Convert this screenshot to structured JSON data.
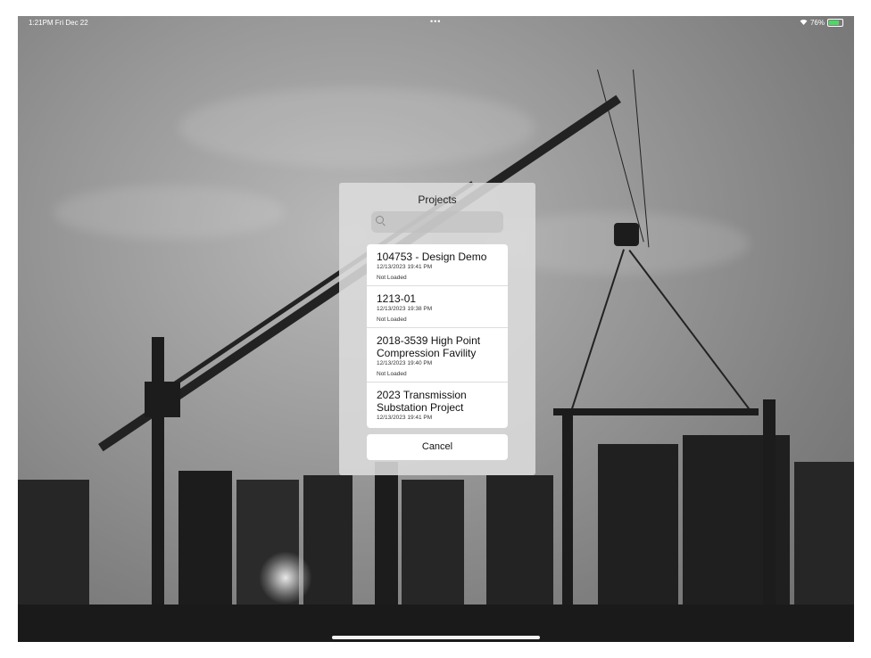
{
  "status_bar": {
    "time": "1:21PM  Fri Dec 22",
    "dots": "•••",
    "battery": "76%"
  },
  "popover": {
    "title": "Projects",
    "search": {
      "placeholder": ""
    },
    "projects": [
      {
        "name": "104753 - Design Demo",
        "date": "12/13/2023 19:41 PM",
        "status": "Not Loaded"
      },
      {
        "name": "1213-01",
        "date": "12/13/2023 19:38 PM",
        "status": "Not Loaded"
      },
      {
        "name": "2018-3539 High Point Compression Favility",
        "date": "12/13/2023 19:40 PM",
        "status": "Not Loaded"
      },
      {
        "name": "2023 Transmission Substation Project",
        "date": "12/13/2023 19:41 PM",
        "status": ""
      }
    ],
    "cancel_label": "Cancel"
  },
  "icons": {
    "search": "magnifier-icon",
    "wifi": "wifi-icon",
    "battery": "battery-charging-icon"
  },
  "colors": {
    "battery_fill": "#4cd964",
    "popover_bg": "#dcdcdc"
  }
}
